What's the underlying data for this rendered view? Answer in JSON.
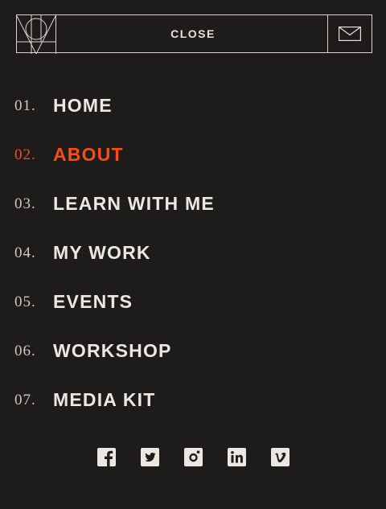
{
  "header": {
    "close_label": "CLOSE",
    "logo_icon": "pin-logo-icon",
    "mail_icon": "envelope-icon"
  },
  "nav": {
    "items": [
      {
        "number": "01.",
        "label": "HOME",
        "active": false
      },
      {
        "number": "02.",
        "label": "ABOUT",
        "active": true
      },
      {
        "number": "03.",
        "label": "LEARN WITH ME",
        "active": false
      },
      {
        "number": "04.",
        "label": "MY WORK",
        "active": false
      },
      {
        "number": "05.",
        "label": "EVENTS",
        "active": false
      },
      {
        "number": "06.",
        "label": "WORKSHOP",
        "active": false
      },
      {
        "number": "07.",
        "label": "MEDIA KIT",
        "active": false
      }
    ]
  },
  "social": {
    "icons": [
      "facebook-icon",
      "twitter-icon",
      "instagram-icon",
      "linkedin-icon",
      "vimeo-icon"
    ]
  },
  "colors": {
    "background": "#1e1c1b",
    "text": "#ece7e0",
    "accent": "#ff4b16",
    "border": "#d9d4cd"
  }
}
